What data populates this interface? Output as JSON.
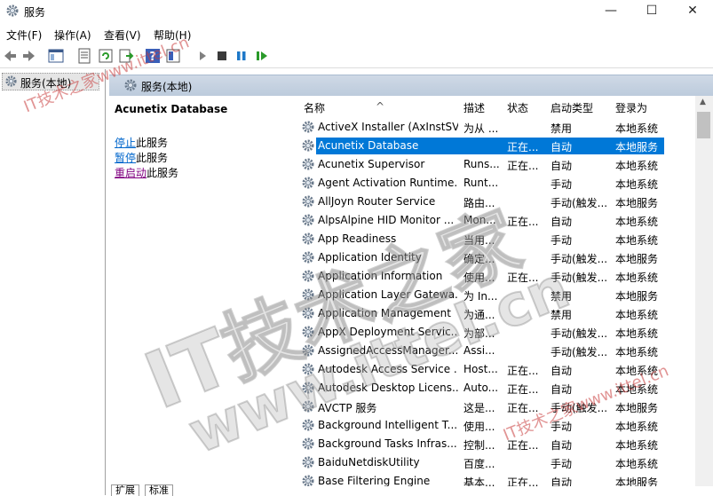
{
  "window": {
    "title": "服务"
  },
  "window_controls": {
    "minimize": "—",
    "maximize": "☐",
    "close": "✕"
  },
  "menu": [
    "文件(F)",
    "操作(A)",
    "查看(V)",
    "帮助(H)"
  ],
  "tree": {
    "root_label": "服务(本地)"
  },
  "header": {
    "title": "服务(本地)"
  },
  "description_pane": {
    "service_name": "Acunetix Database",
    "actions": [
      {
        "link": "停止",
        "rest": "此服务"
      },
      {
        "link": "暂停",
        "rest": "此服务"
      },
      {
        "link": "重启动",
        "rest": "此服务"
      }
    ]
  },
  "columns": {
    "name": "名称",
    "description": "描述",
    "status": "状态",
    "startup": "启动类型",
    "logon": "登录为"
  },
  "services": [
    {
      "name": "ActiveX Installer (AxInstSV)",
      "desc": "为从 ...",
      "status": "",
      "startup": "禁用",
      "logon": "本地系统"
    },
    {
      "name": "Acunetix Database",
      "desc": "",
      "status": "正在...",
      "startup": "自动",
      "logon": "本地服务",
      "selected": true
    },
    {
      "name": "Acunetix Supervisor",
      "desc": "Runs...",
      "status": "正在...",
      "startup": "自动",
      "logon": "本地系统"
    },
    {
      "name": "Agent Activation Runtime...",
      "desc": "Runt...",
      "status": "",
      "startup": "手动",
      "logon": "本地系统"
    },
    {
      "name": "AllJoyn Router Service",
      "desc": "路由...",
      "status": "",
      "startup": "手动(触发...",
      "logon": "本地服务"
    },
    {
      "name": "AlpsAlpine HID Monitor ...",
      "desc": "Mon...",
      "status": "正在...",
      "startup": "自动",
      "logon": "本地系统"
    },
    {
      "name": "App Readiness",
      "desc": "当用...",
      "status": "",
      "startup": "手动",
      "logon": "本地系统"
    },
    {
      "name": "Application Identity",
      "desc": "确定...",
      "status": "",
      "startup": "手动(触发...",
      "logon": "本地服务"
    },
    {
      "name": "Application Information",
      "desc": "使用...",
      "status": "正在...",
      "startup": "手动(触发...",
      "logon": "本地系统"
    },
    {
      "name": "Application Layer Gatewa...",
      "desc": "为 In...",
      "status": "",
      "startup": "禁用",
      "logon": "本地服务"
    },
    {
      "name": "Application Management",
      "desc": "为通...",
      "status": "",
      "startup": "禁用",
      "logon": "本地系统"
    },
    {
      "name": "AppX Deployment Servic...",
      "desc": "为部...",
      "status": "",
      "startup": "手动(触发...",
      "logon": "本地系统"
    },
    {
      "name": "AssignedAccessManager...",
      "desc": "Assi...",
      "status": "",
      "startup": "手动(触发...",
      "logon": "本地系统"
    },
    {
      "name": "Autodesk Access Service ...",
      "desc": "Host...",
      "status": "正在...",
      "startup": "自动",
      "logon": "本地系统"
    },
    {
      "name": "Autodesk Desktop Licens...",
      "desc": "Auto...",
      "status": "正在...",
      "startup": "自动",
      "logon": "本地系统"
    },
    {
      "name": "AVCTP 服务",
      "desc": "这是...",
      "status": "正在...",
      "startup": "手动(触发...",
      "logon": "本地服务"
    },
    {
      "name": "Background Intelligent T...",
      "desc": "使用...",
      "status": "",
      "startup": "手动",
      "logon": "本地系统"
    },
    {
      "name": "Background Tasks Infras...",
      "desc": "控制...",
      "status": "正在...",
      "startup": "自动",
      "logon": "本地系统"
    },
    {
      "name": "BaiduNetdiskUtility",
      "desc": "百度...",
      "status": "",
      "startup": "手动",
      "logon": "本地系统"
    },
    {
      "name": "Base Filtering Engine",
      "desc": "基本...",
      "status": "正在...",
      "startup": "自动",
      "logon": "本地服务"
    }
  ],
  "tabs": [
    "扩展",
    "标准"
  ],
  "watermarks": {
    "small": "IT技术之家www.ittel.cn",
    "big1": "IT技术之家",
    "big2": "www.ittel.cn"
  },
  "colors": {
    "selection": "#0078d7",
    "header_band": "#c5d3e3",
    "link": "#0066cc",
    "visited_link": "#800080"
  }
}
